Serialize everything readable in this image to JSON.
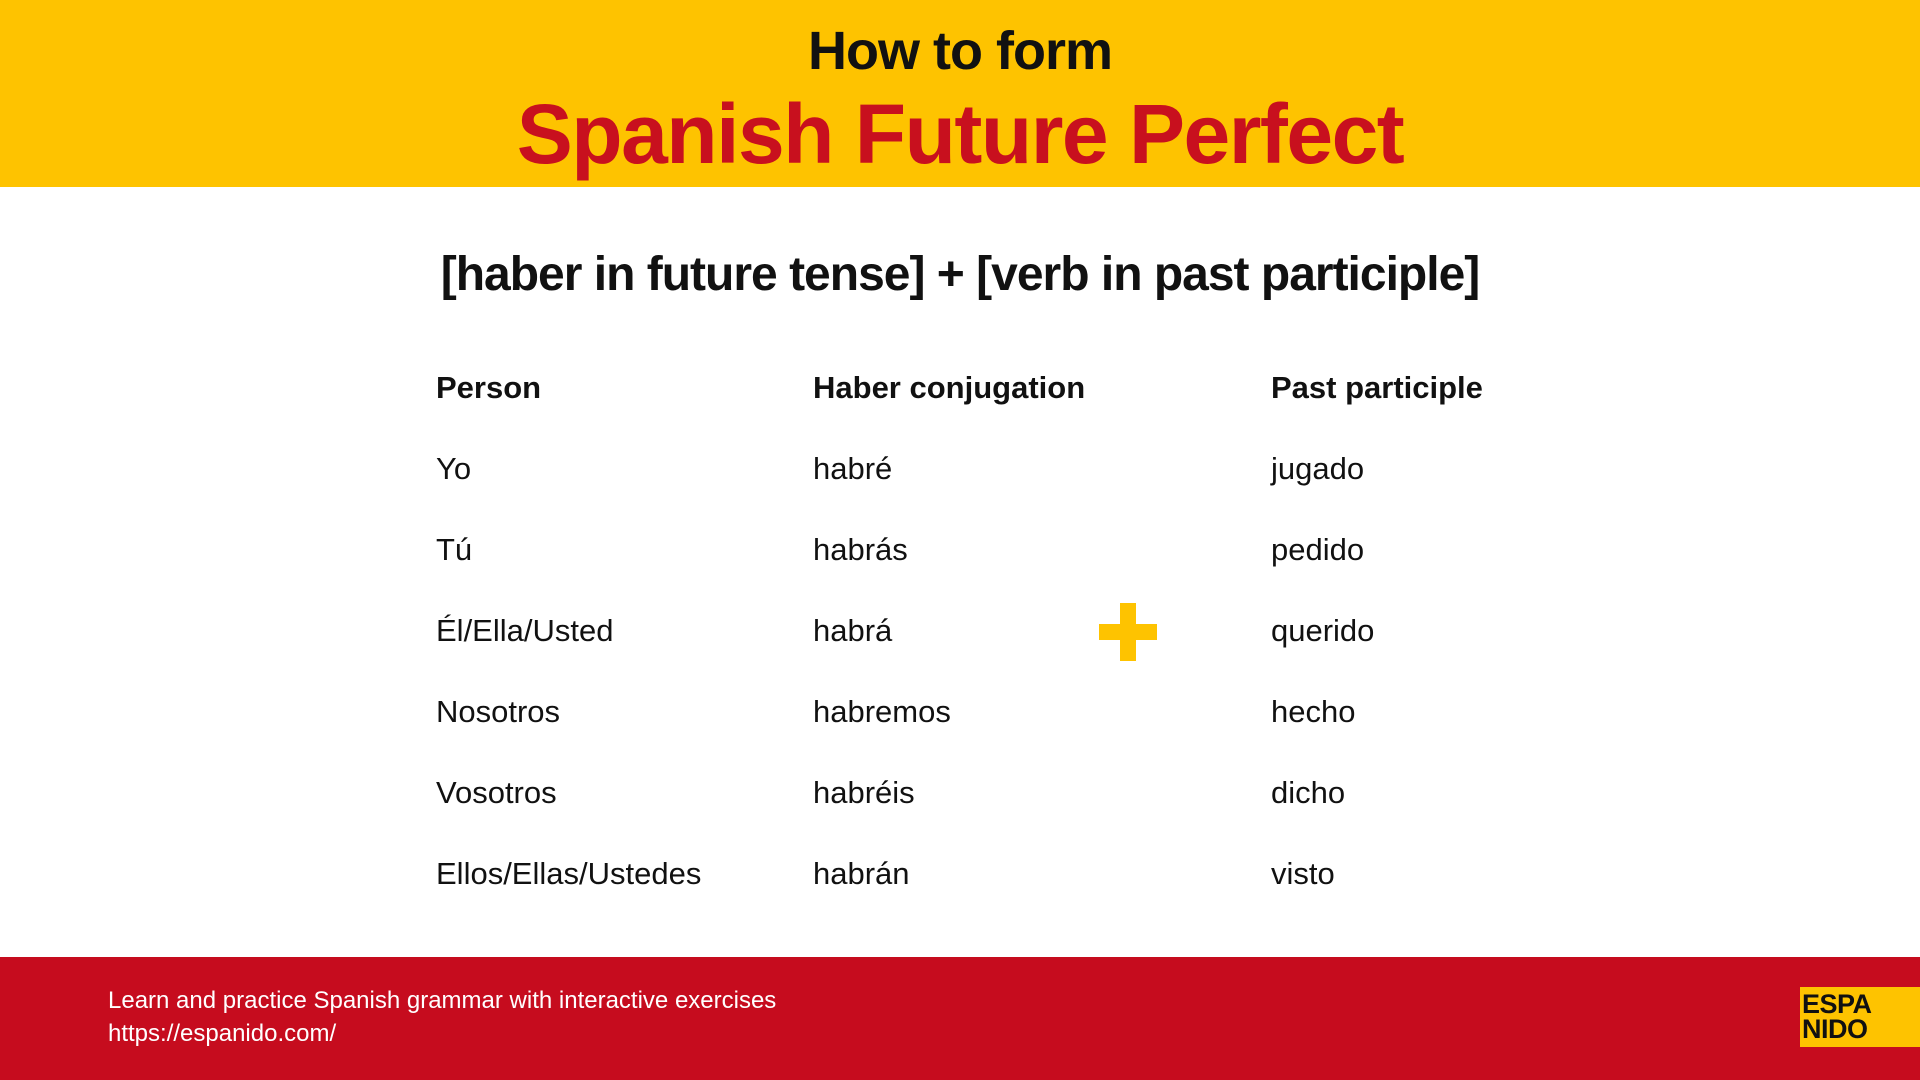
{
  "header": {
    "subtitle": "How to form",
    "title": "Spanish Future Perfect"
  },
  "formula": "[haber in future tense] + [verb in past participle]",
  "table": {
    "headers": [
      "Person",
      "Haber conjugation",
      "Past participle"
    ],
    "rows": [
      [
        "Yo",
        "habré",
        "jugado"
      ],
      [
        "Tú",
        "habrás",
        "pedido"
      ],
      [
        "Él/Ella/Usted",
        "habrá",
        "querido"
      ],
      [
        "Nosotros",
        "habremos",
        "hecho"
      ],
      [
        "Vosotros",
        "habréis",
        "dicho"
      ],
      [
        "Ellos/Ellas/Ustedes",
        "habrán",
        "visto"
      ]
    ]
  },
  "plus_icon": "plus-icon",
  "footer": {
    "tagline": "Learn and practice Spanish grammar with interactive exercises",
    "url": "https://espanido.com/",
    "logo_line1": "ESPA",
    "logo_line2": "NIDO"
  },
  "colors": {
    "yellow": "#fec300",
    "red": "#c8101e",
    "footer_red": "#c60c1e"
  }
}
